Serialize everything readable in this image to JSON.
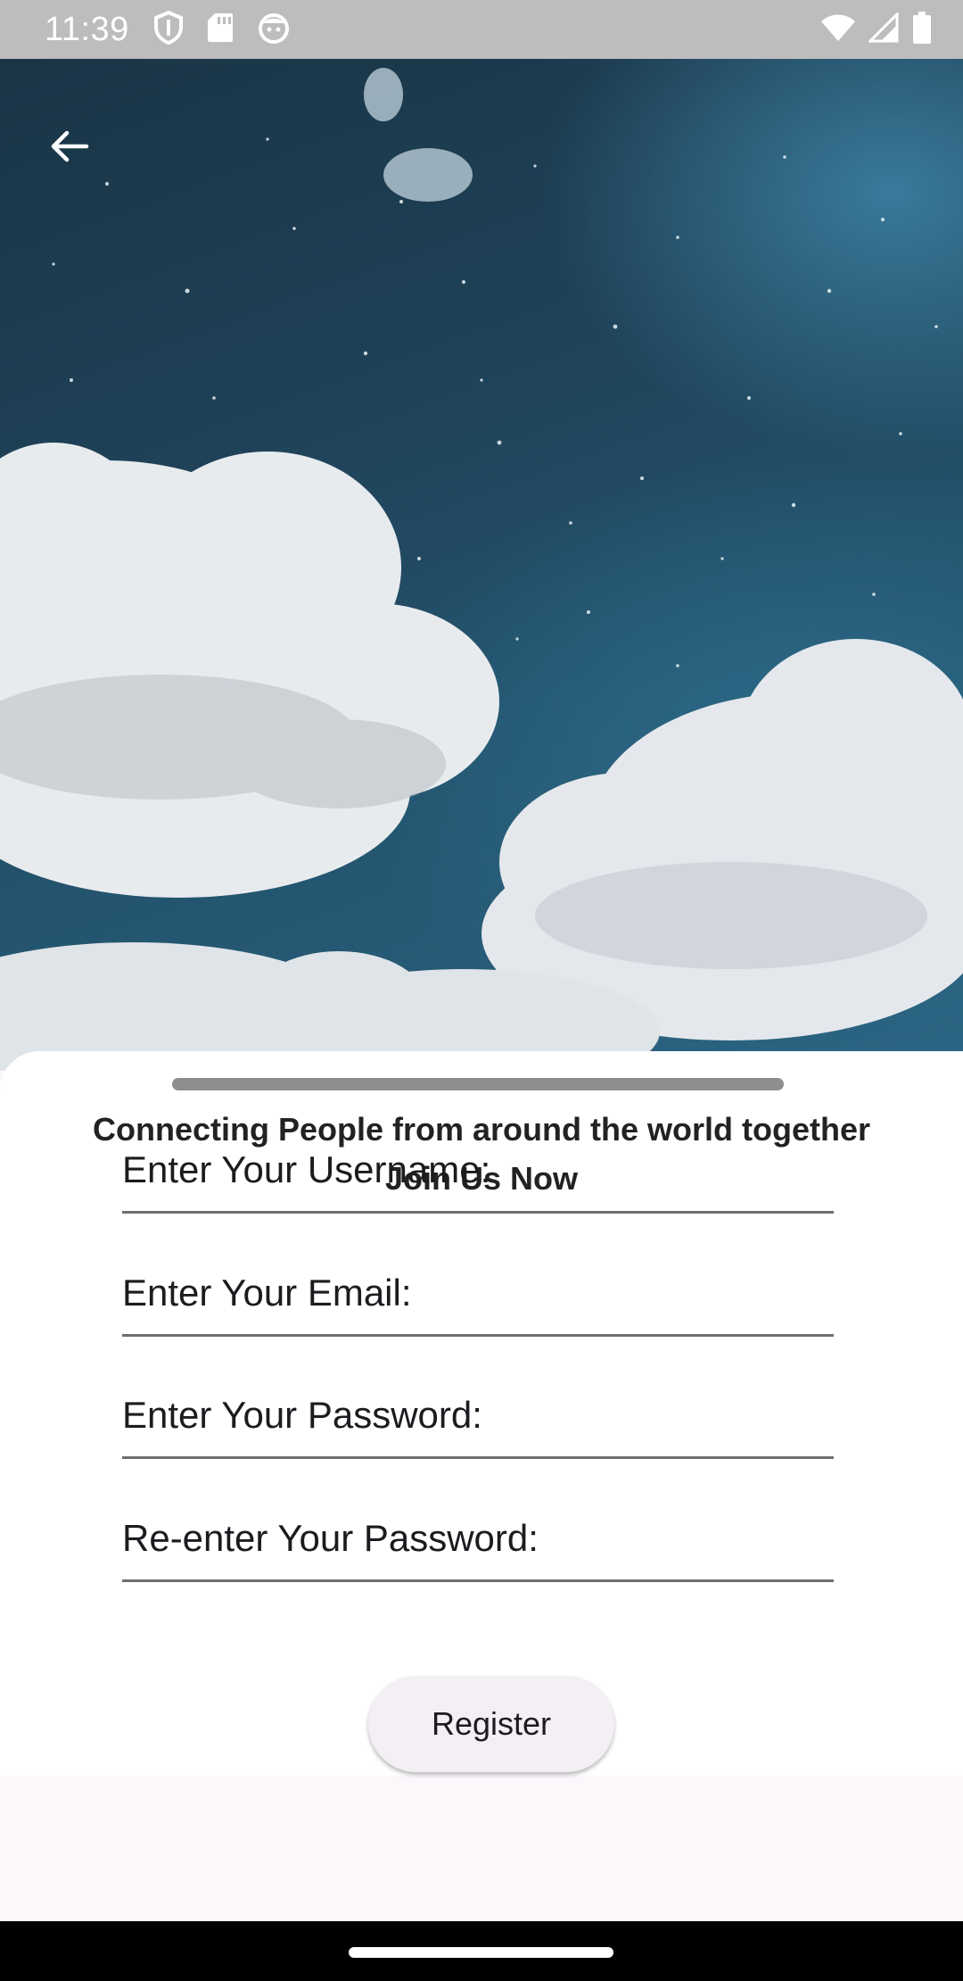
{
  "status_bar": {
    "time": "11:39",
    "left_icons": [
      "shield-icon",
      "sd-card-icon",
      "face-icon"
    ],
    "right_icons": [
      "wifi-icon",
      "signal-icon",
      "battery-icon"
    ]
  },
  "header": {
    "back_icon": "arrow-back-icon"
  },
  "colors": {
    "sheet_background": "#ffffff",
    "button_background": "#f4eff5",
    "text": "#1d1b20",
    "underline": "#6f6f72",
    "sky": "#1f4258"
  },
  "sheet": {
    "tagline_line1": "Connecting People from around the world together",
    "tagline_line2": "Join Us Now",
    "fields": {
      "username": {
        "placeholder": "Enter Your Username:",
        "value": ""
      },
      "email": {
        "placeholder": "Enter Your Email:",
        "value": ""
      },
      "password": {
        "placeholder": "Enter Your Password:",
        "value": ""
      },
      "confirm_password": {
        "placeholder": "Re-enter Your Password:",
        "value": ""
      }
    },
    "register_label": "Register"
  }
}
